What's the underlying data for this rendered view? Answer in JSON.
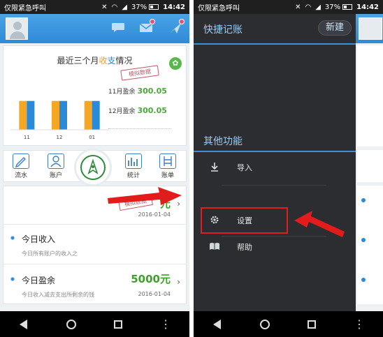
{
  "status_bar": {
    "carrier": "仅限紧急呼叫",
    "battery": "37%",
    "time": "14:42"
  },
  "left": {
    "header": {
      "icons": [
        "chat-icon",
        "mail-icon",
        "send-icon"
      ]
    },
    "summary": {
      "title_prefix": "最近三个月",
      "title_shou": "收",
      "title_zhi": "支",
      "title_suffix": "情况",
      "stamp": "模拟数据",
      "surplus_rows": [
        {
          "label": "11月盈余",
          "value": "300.05"
        },
        {
          "label": "12月盈余",
          "value": "300.05"
        }
      ]
    },
    "chart_data": {
      "type": "bar",
      "categories": [
        "11",
        "12",
        "01"
      ],
      "series": [
        {
          "values": [
            3,
            3,
            3
          ],
          "color": "#f5a623"
        },
        {
          "values": [
            3,
            3,
            3
          ],
          "color": "#2a8ad8"
        }
      ],
      "ylim": [
        0,
        4.5
      ]
    },
    "toolbar": [
      {
        "label": "流水",
        "icon": "edit-icon"
      },
      {
        "label": "账户",
        "icon": "account-icon"
      },
      {
        "label": "统计",
        "icon": "chart-icon"
      },
      {
        "label": "账单",
        "icon": "bill-icon"
      }
    ],
    "list": [
      {
        "title": "",
        "subtitle": "",
        "date": "2016-01-04",
        "amount": "元"
      },
      {
        "title": "今日收入",
        "subtitle": "今日所有账户的收入之",
        "date": "",
        "amount": ""
      },
      {
        "title": "今日盈余",
        "subtitle": "今日收入减去支出所剩余的钱",
        "date": "2016-01-04",
        "amount": "5000元"
      }
    ]
  },
  "right": {
    "drawer_title": "快捷记账",
    "new_button": "新建",
    "other_section": "其他功能",
    "items": [
      {
        "label": "导入",
        "icon": "download-icon"
      },
      {
        "label": "设置",
        "icon": "gear-icon"
      },
      {
        "label": "帮助",
        "icon": "book-icon"
      }
    ]
  },
  "colors": {
    "accent_blue": "#2f8ad8",
    "highlight_red": "#e02020",
    "surplus_green": "#4aa83a"
  }
}
